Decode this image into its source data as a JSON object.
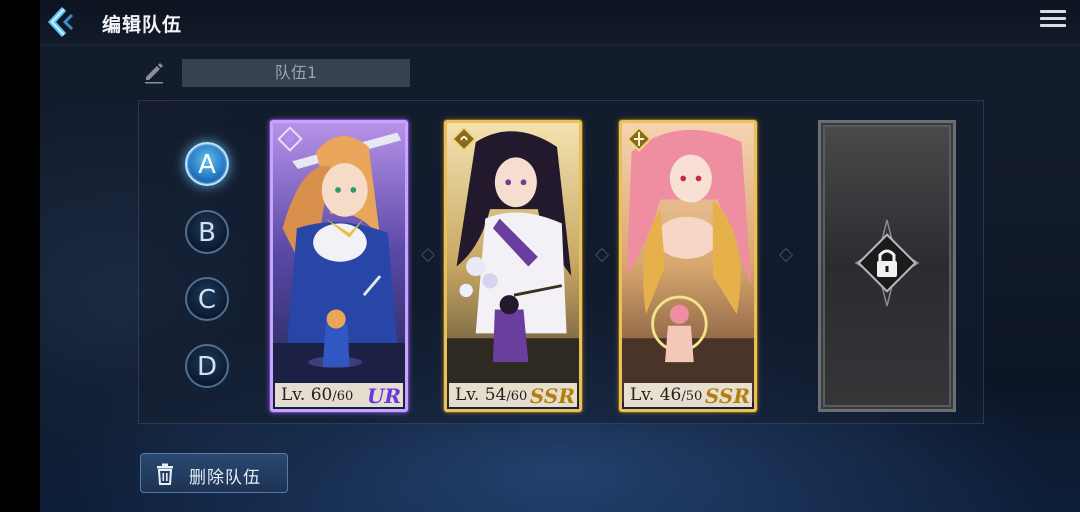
{
  "header": {
    "title": "编辑队伍"
  },
  "team": {
    "name": "队伍1"
  },
  "slots": [
    {
      "letter": "A",
      "active": true
    },
    {
      "letter": "B",
      "active": false
    },
    {
      "letter": "C",
      "active": false
    },
    {
      "letter": "D",
      "active": false
    }
  ],
  "cards": [
    {
      "lv_prefix": "Lv. ",
      "level": "60",
      "max": "/60",
      "rarity": "UR",
      "rarity_color": "#6a38d6"
    },
    {
      "lv_prefix": "Lv. ",
      "level": "54",
      "max": "/60",
      "rarity": "SSR",
      "rarity_color": "#b3800e"
    },
    {
      "lv_prefix": "Lv. ",
      "level": "46",
      "max": "/50",
      "rarity": "SSR",
      "rarity_color": "#b3800e"
    }
  ],
  "locked_slot": {
    "icon": "lock-icon"
  },
  "footer": {
    "delete_label": "删除队伍",
    "delete_icon": "trash-icon"
  },
  "colors": {
    "accent": "#4fb3ea",
    "ur": "#c8a2ff",
    "ssr": "#e7c15a"
  }
}
